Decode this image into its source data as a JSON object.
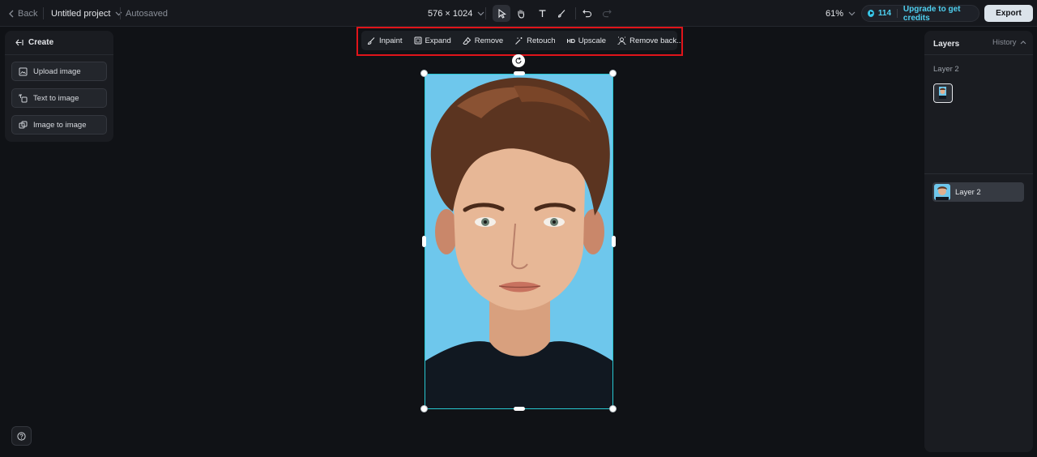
{
  "topbar": {
    "back_label": "Back",
    "project_name": "Untitled project",
    "status": "Autosaved",
    "canvas_size": "576 × 1024",
    "tools": [
      "select-tool",
      "hand-tool",
      "text-tool",
      "brush-tool",
      "undo",
      "redo"
    ],
    "zoom": "61%",
    "credits_count": "114",
    "upgrade_label": "Upgrade to get credits",
    "export_label": "Export"
  },
  "left_panel": {
    "title": "Create",
    "buttons": [
      {
        "label": "Upload image",
        "icon": "upload-image-icon"
      },
      {
        "label": "Text to image",
        "icon": "text-to-image-icon"
      },
      {
        "label": "Image to image",
        "icon": "image-to-image-icon"
      }
    ]
  },
  "edit_toolbar": {
    "items": [
      {
        "label": "Inpaint",
        "icon": "inpaint-icon"
      },
      {
        "label": "Expand",
        "icon": "expand-icon"
      },
      {
        "label": "Remove",
        "icon": "eraser-icon"
      },
      {
        "label": "Retouch",
        "icon": "magic-wand-icon"
      },
      {
        "label": "Upscale",
        "icon": "hd-icon"
      },
      {
        "label": "Remove back...",
        "icon": "remove-background-icon"
      }
    ],
    "hd_badge": "HD"
  },
  "right_panel": {
    "layers_label": "Layers",
    "history_label": "History",
    "current_layer_title": "Layer 2",
    "layer_rows": [
      {
        "label": "Layer 2"
      }
    ]
  },
  "colors": {
    "background": "#101216",
    "panel": "#1a1c21",
    "accent": "#4fd0f0",
    "selection": "#28c8d2",
    "highlight": "#e0141a",
    "export_button": "#dbe3ea"
  }
}
